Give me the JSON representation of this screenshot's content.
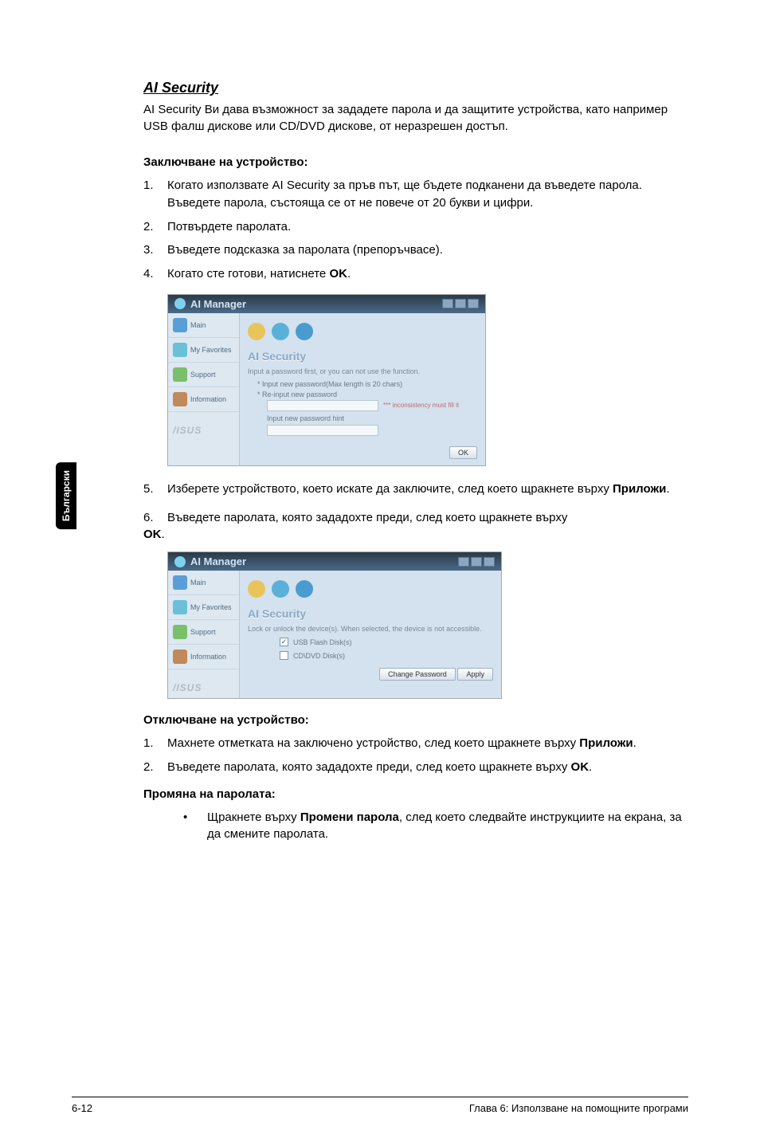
{
  "sideTab": "Български",
  "title": "AI Security",
  "intro": "AI Security Ви дава възможност за зададете парола и да защитите устройства, като например USB фалш дискове или CD/DVD дискове, от неразрешен достъп.",
  "lockHeading": "Заключване на устройство:",
  "lockSteps": [
    "Когато използвате AI Security за пръв път, ще бъдете подканени да въведете парола. Въведете парола, състояща се от не повече от 20 букви и цифри.",
    "Потвърдете паролата.",
    "Въведете подсказка за паролата (препоръчвасе).",
    "Когато сте готови, натиснете "
  ],
  "lockStep4Bold": "OK",
  "lockStep4Tail": ".",
  "lockStep5a": "Изберете устройството, което искате да заключите, след което щракнете върху ",
  "lockStep5Bold": "Приложи",
  "lockStep5Tail": ".",
  "lockStep6a": "Въведете паролата, която зададохте преди, след което щракнете върху ",
  "lockStep6Bold": "OK",
  "lockStep6Tail": ".",
  "shot": {
    "title": "AI Manager",
    "side": {
      "main": "Main",
      "fav": "My Favorites",
      "support": "Support",
      "info": "Information",
      "brand": "/ISUS"
    },
    "panelTitle": "AI Security",
    "sub1": "Input a password first, or you can not use the function.",
    "line1": "* Input new password(Max length is 20 chars)",
    "line2": "* Re-input new password",
    "note": "*** inconsistency must fill it",
    "line3": "Input new password hint",
    "okBtn": "OK",
    "sub2": "Lock or unlock the device(s). When selected, the device is not accessible.",
    "chk1": "USB Flash Disk(s)",
    "chk2": "CD\\DVD Disk(s)",
    "changeBtn": "Change Password",
    "applyBtn": "Apply"
  },
  "unlockHeading": "Отключване на устройство:",
  "unlockSteps": [
    {
      "a": "Махнете отметката на заключено устройство, след което щракнете върху ",
      "b": "Приложи",
      "c": "."
    },
    {
      "a": "Въведете паролата, която зададохте преди, след което щракнете върху ",
      "b": "OK",
      "c": "."
    }
  ],
  "changeHeading": "Промяна на паролата:",
  "changeBullet": {
    "a": "Щракнете върху ",
    "b": "Промени парола",
    "c": ", след което следвайте инструкциите на екрана, за да смените паролата."
  },
  "footer": {
    "left": "6-12",
    "right": "Глава 6: Използване на помощните програми"
  }
}
